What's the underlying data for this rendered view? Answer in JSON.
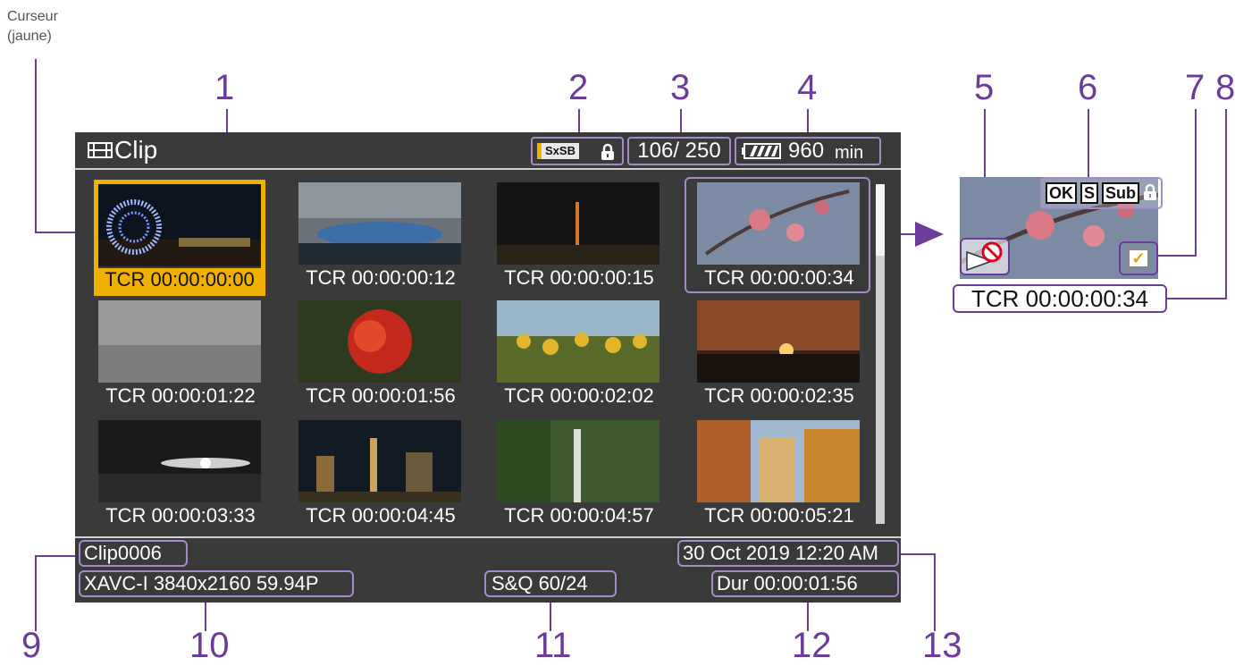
{
  "cursor_caption": "Curseur\n(jaune)",
  "callouts": [
    "1",
    "2",
    "3",
    "4",
    "5",
    "6",
    "7",
    "8",
    "9",
    "10",
    "11",
    "12",
    "13"
  ],
  "screen": {
    "title": "Clip",
    "media_label": "SxSB",
    "clip_count": "106/  250",
    "battery_value": "960",
    "battery_unit": "min",
    "thumbnails": [
      {
        "tcr": "TCR 00:00:00:00",
        "scene": "ferris-wheel-night"
      },
      {
        "tcr": "TCR 00:00:00:12",
        "scene": "stadium-dusk"
      },
      {
        "tcr": "TCR 00:00:00:15",
        "scene": "tower-night"
      },
      {
        "tcr": "TCR 00:00:00:34",
        "scene": "plum-blossom"
      },
      {
        "tcr": "TCR 00:00:01:22",
        "scene": "foggy-field"
      },
      {
        "tcr": "TCR 00:00:01:56",
        "scene": "red-lily"
      },
      {
        "tcr": "TCR 00:00:02:02",
        "scene": "sunflowers"
      },
      {
        "tcr": "TCR 00:00:02:35",
        "scene": "sunset-sea"
      },
      {
        "tcr": "TCR 00:00:03:33",
        "scene": "moon-clouds"
      },
      {
        "tcr": "TCR 00:00:04:45",
        "scene": "city-night"
      },
      {
        "tcr": "TCR 00:00:04:57",
        "scene": "waterfall"
      },
      {
        "tcr": "TCR 00:00:05:21",
        "scene": "autumn-trees"
      }
    ],
    "clip_name": "Clip0006",
    "datetime": "30 Oct 2019 12:20 AM",
    "format": "XAVC-I  3840x2160 59.94P",
    "sq": "S&Q 60/24",
    "duration": "Dur 00:00:01:56"
  },
  "detail": {
    "badges": [
      "OK",
      "S",
      "Sub"
    ],
    "tcr": "TCR 00:00:00:34"
  },
  "colors": {
    "cursor": "#f0b000",
    "callout": "#6a3d9a",
    "frame": "#a48bc8",
    "screen_bg": "#3a3a3a"
  }
}
